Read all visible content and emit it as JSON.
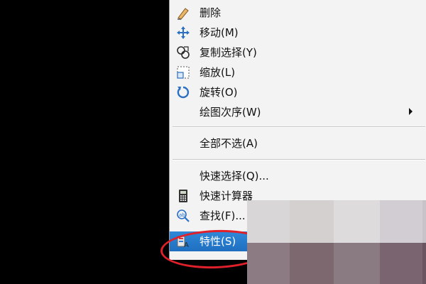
{
  "context_menu": {
    "items": [
      {
        "label": "删除",
        "icon": "erase-icon"
      },
      {
        "label": "移动(M)",
        "icon": "move-icon"
      },
      {
        "label": "复制选择(Y)",
        "icon": "copy-icon"
      },
      {
        "label": "缩放(L)",
        "icon": "scale-icon"
      },
      {
        "label": "旋转(O)",
        "icon": "rotate-icon"
      },
      {
        "label": "绘图次序(W)",
        "icon": "",
        "submenu": true
      },
      {
        "label": "全部不选(A)",
        "icon": ""
      },
      {
        "label": "快速选择(Q)...",
        "icon": ""
      },
      {
        "label": "快速计算器",
        "icon": "calculator-icon"
      },
      {
        "label": "查找(F)...",
        "icon": "find-icon"
      },
      {
        "label": "特性(S)",
        "icon": "properties-icon",
        "selected": true
      }
    ]
  },
  "colors": {
    "background": "#000000",
    "menu_bg": "#f3f3f3",
    "selected_bg": "#2275c8",
    "highlight": "#e0202a"
  },
  "mosaic_colors": [
    [
      "#d9d6d8",
      "#d5d0d0",
      "#dedbdd",
      "#d2cdd2",
      "#c8c3c6"
    ],
    [
      "#8d7b83",
      "#7e6870",
      "#8a7a82",
      "#7a6470",
      "#6b5660"
    ]
  ]
}
